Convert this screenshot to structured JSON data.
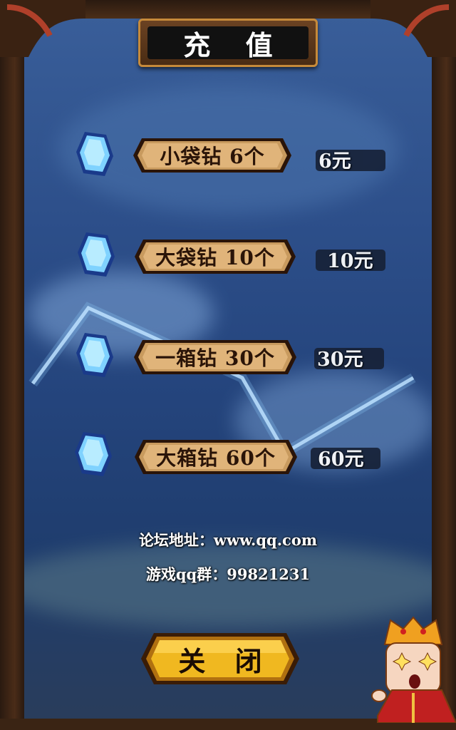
{
  "title": "充 值",
  "packages": [
    {
      "label": "小袋钻  6个",
      "price": "6元"
    },
    {
      "label": "大袋钻  10个",
      "price": "10元"
    },
    {
      "label": "一箱钻  30个",
      "price": "30元"
    },
    {
      "label": "大箱钻  60个",
      "price": "60元"
    }
  ],
  "forum": "论坛地址：www.qq.com",
  "qq_group": "游戏qq群：99821231",
  "close_label": "关 闭",
  "colors": {
    "button_bronze": "#c89a5e",
    "close_gold": "#f0b820",
    "gem_blue": "#6fc8ff",
    "frame_wood": "#4a2c18"
  },
  "icons": {
    "gem": "diamond-gem-icon",
    "mascot": "monk-mascot"
  }
}
